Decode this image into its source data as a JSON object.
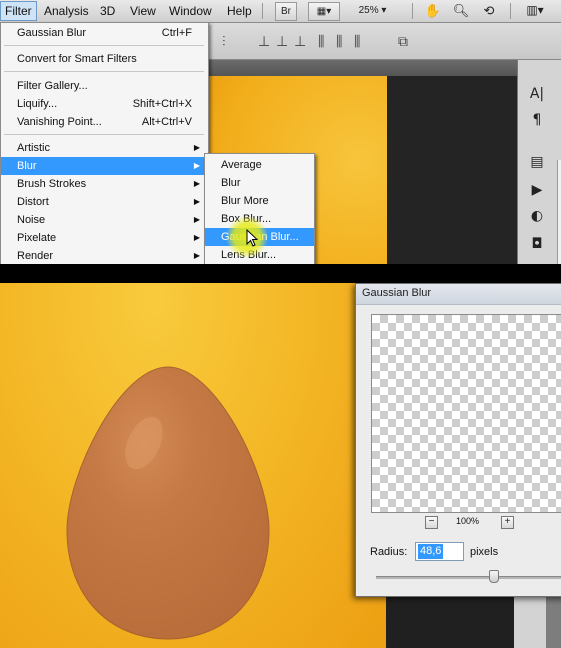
{
  "menubar": {
    "items": [
      "Filter",
      "Analysis",
      "3D",
      "View",
      "Window",
      "Help"
    ],
    "bridge_label": "Br",
    "zoom": "25%"
  },
  "filter_menu": {
    "items": [
      {
        "label": "Gaussian Blur",
        "shortcut": "Ctrl+F"
      },
      {
        "label": "Convert for Smart Filters"
      },
      {
        "label": "Filter Gallery..."
      },
      {
        "label": "Liquify...",
        "shortcut": "Shift+Ctrl+X"
      },
      {
        "label": "Vanishing Point...",
        "shortcut": "Alt+Ctrl+V"
      },
      {
        "label": "Artistic"
      },
      {
        "label": "Blur"
      },
      {
        "label": "Brush Strokes"
      },
      {
        "label": "Distort"
      },
      {
        "label": "Noise"
      },
      {
        "label": "Pixelate"
      },
      {
        "label": "Render"
      }
    ]
  },
  "blur_submenu": {
    "items": [
      "Average",
      "Blur",
      "Blur More",
      "Box Blur...",
      "Gaussian Blur...",
      "Lens Blur..."
    ]
  },
  "dialog": {
    "title": "Gaussian Blur",
    "zoom_minus": "−",
    "zoom_plus": "+",
    "zoom_level": "100%",
    "radius_label": "Radius:",
    "radius_value": "48,6",
    "radius_unit": "pixels",
    "slider_fraction": 0.62
  },
  "colors": {
    "accent": "#3399ff",
    "background_orange": "#f3b524",
    "egg": "#c0733f"
  }
}
